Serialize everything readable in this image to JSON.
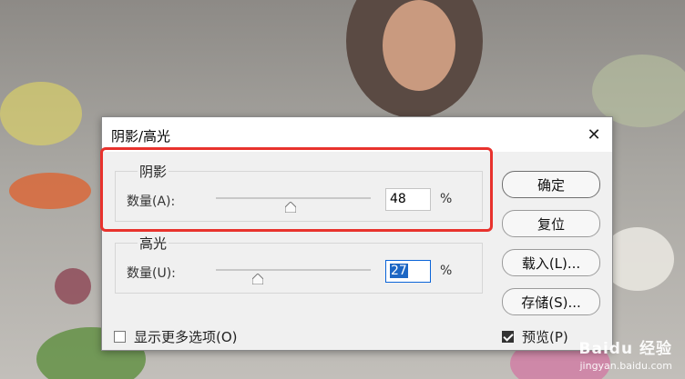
{
  "dialog": {
    "title": "阴影/高光",
    "close_glyph": "✕"
  },
  "shadows": {
    "legend": "阴影",
    "amount_label": "数量(A):",
    "amount_value": "48",
    "amount_percent": 48,
    "unit": "%"
  },
  "highlights": {
    "legend": "高光",
    "amount_label": "数量(U):",
    "amount_value": "27",
    "amount_percent": 27,
    "unit": "%"
  },
  "buttons": {
    "ok": "确定",
    "reset": "复位",
    "load": "载入(L)...",
    "save": "存储(S)..."
  },
  "options": {
    "show_more": "显示更多选项(O)",
    "show_more_checked": false,
    "preview": "预览(P)",
    "preview_checked": true
  },
  "watermark": {
    "brand": "Baidu 经验",
    "url": "jingyan.baidu.com"
  },
  "colors": {
    "highlight_border": "#e8322d",
    "selection": "#1d67c4"
  }
}
